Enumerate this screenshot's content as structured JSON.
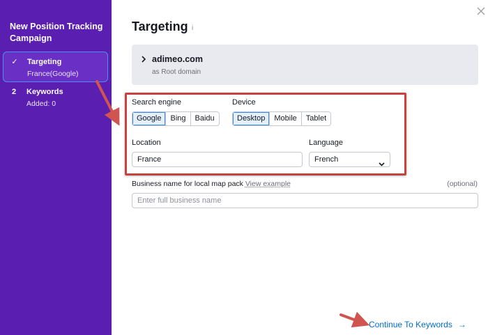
{
  "sidebar": {
    "title": "New Position Tracking Campaign",
    "steps": [
      {
        "marker": "✓",
        "label": "Targeting",
        "sub": "France(Google)"
      },
      {
        "marker": "2",
        "label": "Keywords",
        "sub": "Added: 0"
      }
    ]
  },
  "header": {
    "title": "Targeting",
    "info": "i"
  },
  "domain": {
    "name": "adimeo.com",
    "type": "as Root domain"
  },
  "search_engine": {
    "label": "Search engine",
    "options": [
      "Google",
      "Bing",
      "Baidu"
    ],
    "selected": "Google"
  },
  "device": {
    "label": "Device",
    "options": [
      "Desktop",
      "Mobile",
      "Tablet"
    ],
    "selected": "Desktop"
  },
  "location": {
    "label": "Location",
    "value": "France"
  },
  "language": {
    "label": "Language",
    "value": "French"
  },
  "business": {
    "label": "Business name for local map pack",
    "link": "View example",
    "optional": "(optional)",
    "placeholder": "Enter full business name"
  },
  "footer": {
    "continue_label": "Continue To Keywords",
    "continue_arrow": "→"
  },
  "colors": {
    "sidebar": "#5a1fb0",
    "accent": "#006dca",
    "highlight": "#c8423f",
    "selected": "#e3f0fb"
  }
}
